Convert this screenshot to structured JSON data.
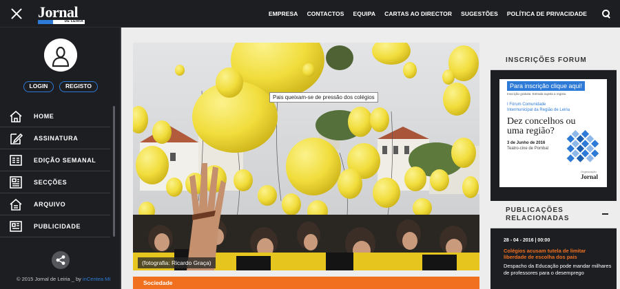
{
  "header": {
    "logo_text": "Jornal",
    "logo_sub": "DE LEIRIA",
    "nav": [
      "EMPRESA",
      "CONTACTOS",
      "EQUIPA",
      "CARTAS AO DIRECTOR",
      "SUGESTÕES",
      "POLÍTICA DE PRIVACIDADE"
    ]
  },
  "sidebar": {
    "login_label": "LOGIN",
    "register_label": "REGISTO",
    "menu": [
      {
        "label": "HOME",
        "icon": "home-icon"
      },
      {
        "label": "ASSINATURA",
        "icon": "edit-icon"
      },
      {
        "label": "EDIÇÃO SEMANAL",
        "icon": "newspaper-icon"
      },
      {
        "label": "SECÇÕES",
        "icon": "sections-icon"
      },
      {
        "label": "ARQUIVO",
        "icon": "archive-icon"
      },
      {
        "label": "PUBLICIDADE",
        "icon": "advertising-icon"
      }
    ],
    "copyright_prefix": "© 2015 Jornal de Leiria _ by ",
    "copyright_link": "inCentea MI"
  },
  "article": {
    "tooltip": "Pais queixam-se de pressão dos colégios",
    "caption": "(fotografia: Ricardo Graça)",
    "category": "Sociedade"
  },
  "forum": {
    "title": "INSCRIÇÕES FORUM",
    "ad_cta": "Para inscrição clique aqui!",
    "ad_small": "Inscrição gratuita. Entrada sujeita a registo.",
    "ad_event_line1": "I Fórum Comunidade",
    "ad_event_line2": "Intermunicipal da Região de Leiria",
    "ad_headline": "Dez concelhos ou uma região?",
    "ad_date": "3 de Junho de 2016",
    "ad_venue": "Teatro-cine de Pombal",
    "ad_org_label": "Organização",
    "ad_org_name": "Jornal"
  },
  "related": {
    "title": "PUBLICAÇÕES RELACIONADAS",
    "items": [
      {
        "date": "28 - 04 - 2016 | 00:00",
        "title": "Colégios acusam tutela de limitar liberdade de escolha dos pais",
        "summary": "Despacho da Educação pode mandar milhares de professores para o desemprego"
      }
    ]
  },
  "colors": {
    "dark": "#1d1e22",
    "accent_blue": "#2d7bd6",
    "accent_orange": "#f07020",
    "balloon_yellow": "#f3e046"
  }
}
